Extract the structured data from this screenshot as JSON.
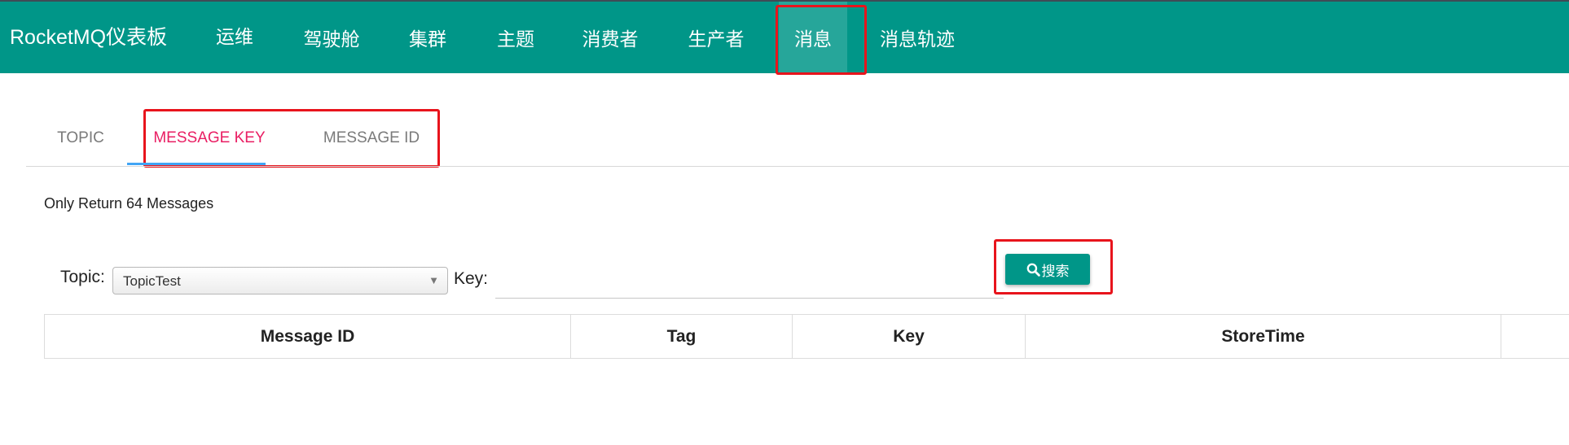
{
  "header": {
    "brand": "RocketMQ仪表板",
    "nav": [
      {
        "label": "运维"
      },
      {
        "label": "驾驶舱"
      },
      {
        "label": "集群"
      },
      {
        "label": "主题"
      },
      {
        "label": "消费者"
      },
      {
        "label": "生产者"
      },
      {
        "label": "消息",
        "active": true
      },
      {
        "label": "消息轨迹"
      }
    ]
  },
  "tabs": [
    {
      "label": "TOPIC"
    },
    {
      "label": "MESSAGE KEY",
      "active": true
    },
    {
      "label": "MESSAGE ID"
    }
  ],
  "notice": "Only Return 64 Messages",
  "form": {
    "topic_label": "Topic:",
    "topic_value": "TopicTest",
    "key_label": "Key:",
    "key_value": "",
    "search_label": "搜索"
  },
  "table": {
    "columns": [
      "Message ID",
      "Tag",
      "Key",
      "StoreTime"
    ]
  },
  "colors": {
    "primary": "#009688",
    "active_tab": "#e91e63",
    "highlight": "#e8141c"
  },
  "icons": {
    "search": "search-icon",
    "caret": "chevron-down-icon"
  }
}
